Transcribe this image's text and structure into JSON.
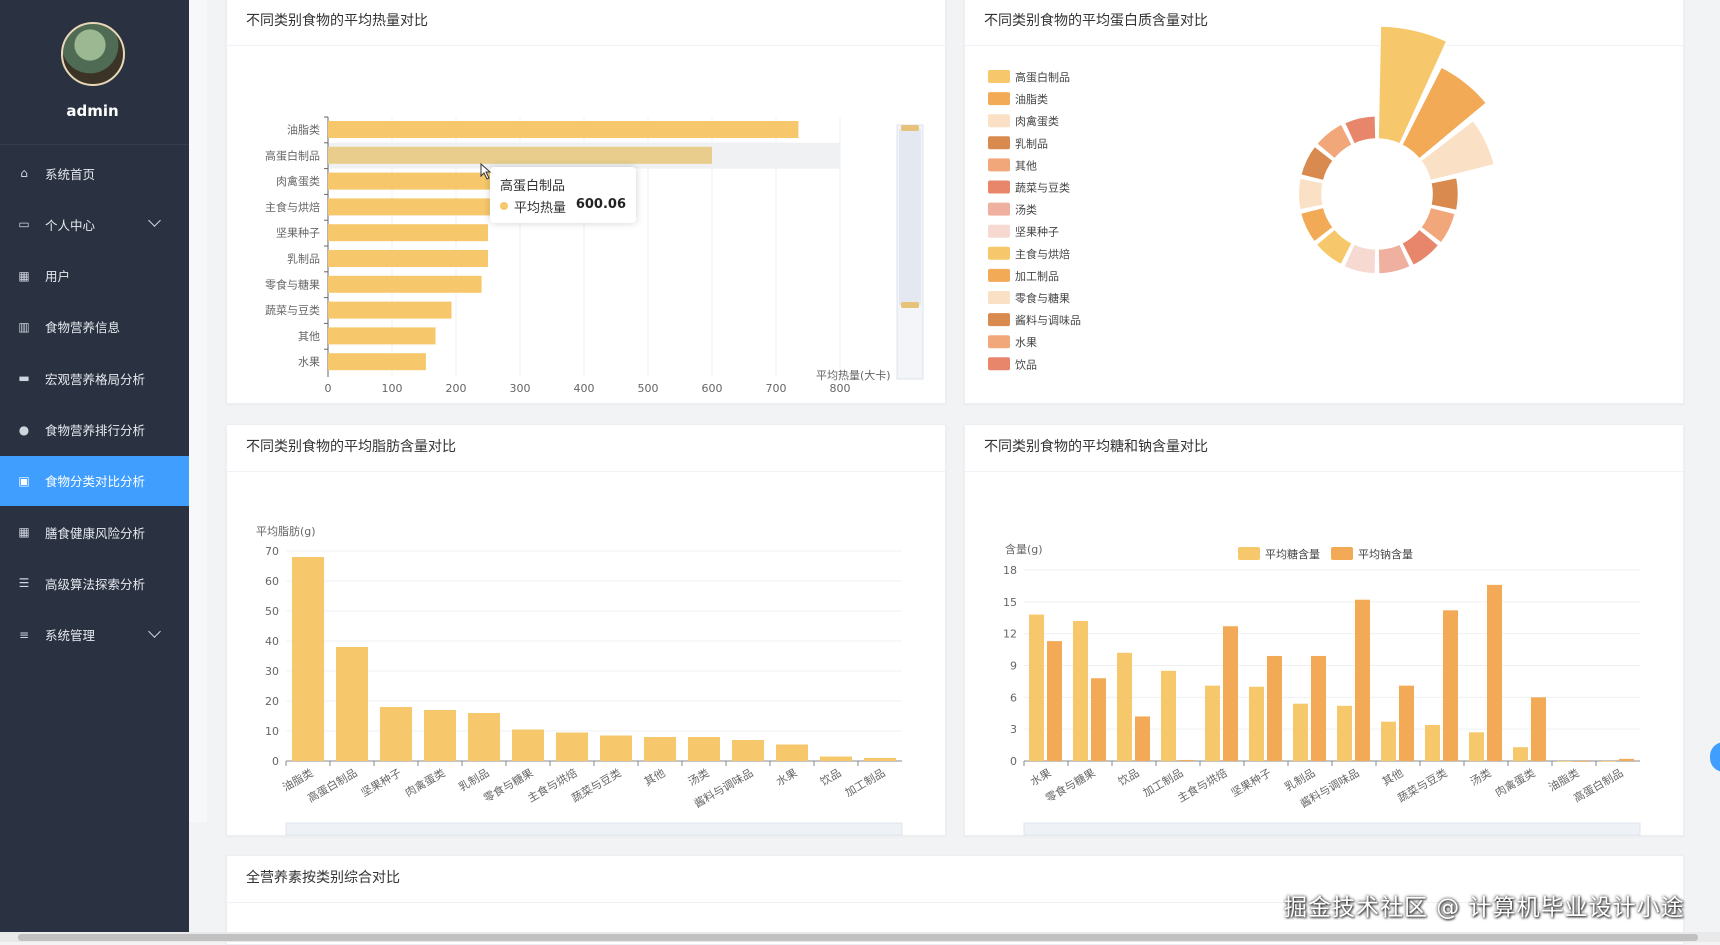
{
  "sidebar": {
    "username": "admin",
    "items": [
      {
        "label": "系统首页",
        "icon": "home-icon",
        "active": false,
        "expandable": false
      },
      {
        "label": "个人中心",
        "icon": "profile-icon",
        "active": false,
        "expandable": true
      },
      {
        "label": "用户",
        "icon": "grid-icon",
        "active": false,
        "expandable": false
      },
      {
        "label": "食物营养信息",
        "icon": "library-icon",
        "active": false,
        "expandable": false
      },
      {
        "label": "宏观营养格局分析",
        "icon": "monitor-icon",
        "active": false,
        "expandable": false
      },
      {
        "label": "食物营养排行分析",
        "icon": "location-icon",
        "active": false,
        "expandable": false
      },
      {
        "label": "食物分类对比分析",
        "icon": "clipboard-icon",
        "active": true,
        "expandable": false
      },
      {
        "label": "膳食健康风险分析",
        "icon": "grid-icon",
        "active": false,
        "expandable": false
      },
      {
        "label": "高级算法探索分析",
        "icon": "list-icon",
        "active": false,
        "expandable": false
      },
      {
        "label": "系统管理",
        "icon": "settings-icon",
        "active": false,
        "expandable": true
      }
    ]
  },
  "colors": {
    "sidebar_bg": "#2a3140",
    "active_bg": "#409eff",
    "palette": [
      "#f7c86b",
      "#f2aa57",
      "#fae0c4",
      "#d98a4f",
      "#f2a77b",
      "#e8866b",
      "#f0b0a0",
      "#f6d9d0"
    ]
  },
  "main": {
    "cards": [
      {
        "id": "calories",
        "title": "不同类别食物的平均热量对比",
        "chart_data": {
          "type": "bar",
          "orientation": "horizontal",
          "categories": [
            "油脂类",
            "高蛋白制品",
            "肉禽蛋类",
            "主食与烘焙",
            "坚果种子",
            "乳制品",
            "零食与糖果",
            "蔬菜与豆类",
            "其他",
            "水果"
          ],
          "values": [
            735,
            600.06,
            255,
            253,
            250,
            250,
            240,
            193,
            168,
            153
          ],
          "xlabel": "平均热量(大卡)",
          "xlim": [
            0,
            800
          ],
          "xticks": [
            "0",
            "100",
            "200",
            "300",
            "400",
            "500",
            "600",
            "700",
            "800"
          ],
          "color": "#f7c86b",
          "highlight_category": "高蛋白制品",
          "datazoom": "vertical slider at right",
          "tooltip": {
            "title": "高蛋白制品",
            "series": "平均热量",
            "value": "600.06"
          }
        }
      },
      {
        "id": "protein",
        "title": "不同类别食物的平均蛋白质含量对比",
        "chart_data": {
          "type": "pie",
          "variant": "rose",
          "legend_position": "left",
          "categories": [
            "高蛋白制品",
            "油脂类",
            "肉禽蛋类",
            "乳制品",
            "其他",
            "蔬菜与豆类",
            "汤类",
            "坚果种子",
            "主食与烘焙",
            "加工制品",
            "零食与糖果",
            "酱料与调味品",
            "水果",
            "饮品"
          ],
          "values": [
            22,
            16,
            11,
            5,
            4.5,
            4.2,
            4,
            4,
            3.5,
            3.3,
            3.2,
            3.1,
            3,
            2.9
          ],
          "colors": [
            "#f7c86b",
            "#f2aa57",
            "#fae0c4",
            "#d98a4f",
            "#f2a77b",
            "#e8866b",
            "#f0b0a0",
            "#f6d9d0",
            "#f7c86b",
            "#f2aa57",
            "#fae0c4",
            "#d98a4f",
            "#f2a77b",
            "#e8866b"
          ]
        }
      },
      {
        "id": "fat",
        "title": "不同类别食物的平均脂肪含量对比",
        "chart_data": {
          "type": "bar",
          "categories": [
            "油脂类",
            "高蛋白制品",
            "坚果种子",
            "肉禽蛋类",
            "乳制品",
            "零食与糖果",
            "主食与烘焙",
            "蔬菜与豆类",
            "其他",
            "汤类",
            "酱料与调味品",
            "水果",
            "饮品",
            "加工制品"
          ],
          "values": [
            68,
            38,
            18,
            17,
            16,
            10.5,
            9.5,
            8.5,
            8,
            8,
            7,
            5.5,
            1.5,
            1
          ],
          "ylabel": "平均脂肪(g)",
          "ylim": [
            0,
            70
          ],
          "yticks": [
            "0",
            "10",
            "20",
            "30",
            "40",
            "50",
            "60",
            "70"
          ],
          "color": "#f7c86b",
          "datazoom": "horizontal slider at bottom"
        }
      },
      {
        "id": "sugar-sodium",
        "title": "不同类别食物的平均糖和钠含量对比",
        "chart_data": {
          "type": "bar",
          "categories": [
            "水果",
            "零食与糖果",
            "饮品",
            "加工制品",
            "主食与烘焙",
            "坚果种子",
            "乳制品",
            "酱料与调味品",
            "其他",
            "蔬菜与豆类",
            "汤类",
            "肉禽蛋类",
            "油脂类",
            "高蛋白制品"
          ],
          "series": [
            {
              "name": "平均糖含量",
              "color": "#f7c86b",
              "values": [
                13.8,
                13.2,
                10.2,
                8.5,
                7.1,
                7,
                5.4,
                5.2,
                3.7,
                3.4,
                2.7,
                1.3,
                0,
                0
              ]
            },
            {
              "name": "平均钠含量",
              "color": "#f2aa57",
              "values": [
                11.3,
                7.8,
                4.2,
                0.1,
                12.7,
                9.9,
                9.9,
                15.2,
                7.1,
                14.2,
                16.6,
                6,
                0,
                0.2
              ]
            }
          ],
          "ylabel": "含量(g)",
          "ylim": [
            0,
            18
          ],
          "yticks": [
            "0",
            "3",
            "6",
            "9",
            "12",
            "15",
            "18"
          ],
          "legend_position": "top",
          "datazoom": "horizontal slider at bottom"
        }
      },
      {
        "id": "all-nutrients",
        "title": "全营养素按类别综合对比"
      }
    ]
  },
  "watermark": "掘金技术社区 @ 计算机毕业设计小途"
}
